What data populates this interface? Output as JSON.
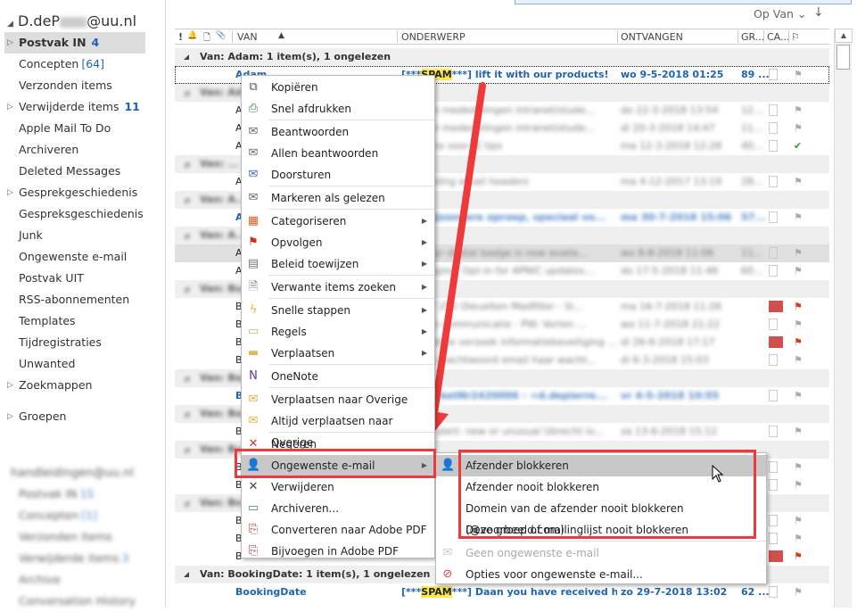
{
  "sidebar": {
    "account": {
      "prefix": "D.deP",
      "suffix": "@uu.nl"
    },
    "folders": [
      {
        "label": "Postvak IN",
        "count": "4",
        "expandable": true,
        "selected": true
      },
      {
        "label": "Concepten",
        "count": "[64]"
      },
      {
        "label": "Verzonden items"
      },
      {
        "label": "Verwijderde items",
        "count": "11",
        "expandable": true
      },
      {
        "label": "Apple Mail To Do"
      },
      {
        "label": "Archiveren"
      },
      {
        "label": "Deleted Messages"
      },
      {
        "label": "Gesprekgeschiedenis",
        "expandable": true
      },
      {
        "label": "Gespreksgeschiedenis"
      },
      {
        "label": "Junk"
      },
      {
        "label": "Ongewenste e-mail"
      },
      {
        "label": "Postvak UIT"
      },
      {
        "label": "RSS-abonnementen"
      },
      {
        "label": "Templates"
      },
      {
        "label": "Tijdregistraties"
      },
      {
        "label": "Unwanted"
      },
      {
        "label": "Zoekmappen",
        "expandable": true
      }
    ],
    "groups_label": "Groepen",
    "second_account": "handleidingen@uu.nl",
    "second_folders": [
      {
        "label": "Postvak IN",
        "count": "15"
      },
      {
        "label": "Concepten",
        "count": "[1]"
      },
      {
        "label": "Verzonden items"
      },
      {
        "label": "Verwijderde items",
        "count": "3"
      },
      {
        "label": "Archive"
      },
      {
        "label": "Conversation History"
      }
    ]
  },
  "toolbar": {
    "sort_label": "Op Van",
    "sort_chevron": "chevron-down-icon",
    "sort_direction": "↓"
  },
  "columns": [
    "!",
    "🔔",
    "🗋",
    "📎",
    "VAN",
    "ONDERWERP",
    "ONTVANGEN",
    "GR...",
    "CA...",
    "⚐"
  ],
  "rows": [
    {
      "kind": "group",
      "text": "Van: Adam: 1 item(s), 1 ongelezen"
    },
    {
      "kind": "item",
      "from": "Adam",
      "tag_open": "[***",
      "spam": "SPAM",
      "tag_close": "***]",
      "subject": " lift it with our products!",
      "date": "wo 9-5-2018 01:25",
      "size": "89 ...",
      "unread": true,
      "selected": true
    },
    {
      "kind": "group",
      "text": "Van: Ad...",
      "blur": true
    },
    {
      "kind": "item",
      "from": "A",
      "subject": "...ws en mededelingen intranet/stude...",
      "date": "do 22-3-2018 13:54",
      "size": "12...",
      "blur": true
    },
    {
      "kind": "item",
      "from": "A",
      "subject": "...ws en mededelingen intranet/stude...",
      "date": "di 20-3-2018 14:47",
      "size": "11...",
      "blur": true
    },
    {
      "kind": "item",
      "from": "A",
      "subject": "...pagina voor IE tips",
      "date": "ma 12-3-2018 12:28",
      "size": "40...",
      "blur": true,
      "check": true
    },
    {
      "kind": "group",
      "text": "Van: ...",
      "blur": true
    },
    {
      "kind": "item",
      "from": "A",
      "subject": "...decoding email headers",
      "date": "ma 4-12-2017 13:19",
      "size": "28...",
      "blur": true
    },
    {
      "kind": "group",
      "text": "Van: A...",
      "blur": true
    },
    {
      "kind": "item",
      "from": "A",
      "subject": "***] Bijzondere oproep, speciaal vo...",
      "date": "ma 30-7-2018 15:06",
      "size": "57...",
      "blur": true,
      "unread": true
    },
    {
      "kind": "group",
      "text": "Van: A...",
      "blur": true
    },
    {
      "kind": "item",
      "from": "A",
      "subject": "***] Your digital badge is now availa...",
      "date": "wo 8-8-2018 11:06",
      "size": "11...",
      "blur": true,
      "hl": true
    },
    {
      "kind": "item",
      "from": "A",
      "subject": "...changing. Opt-in for APNIC updates...",
      "date": "do 17-5-2018 11:46",
      "size": "60...",
      "blur": true
    },
    {
      "kind": "group",
      "text": "Van: Bu...",
      "blur": true
    },
    {
      "kind": "item",
      "from": "B",
      "subject": "...1807 252 Oieuelten Madfilter - Si...",
      "date": "ma 16-7-2018 11:26",
      "size": "",
      "blur": true,
      "redcat": true,
      "redflag": true
    },
    {
      "kind": "item",
      "from": "B",
      "subject": "...ng en communicatie - PW: Vorlen ...",
      "date": "wo 11-7-2018 21:22",
      "size": "",
      "blur": true
    },
    {
      "kind": "item",
      "from": "B",
      "subject": "...rvraatste verzoek informatiebeveiliging ...",
      "date": "di 26-6-2018 17:17",
      "size": "",
      "blur": true,
      "redcat": true,
      "redflag": true
    },
    {
      "kind": "item",
      "from": "B",
      "subject": "...rging wachtwoord email haar wacht...",
      "date": "di 6-3-2018 15:03",
      "size": "",
      "blur": true
    },
    {
      "kind": "group",
      "text": "Van: Boch...",
      "blur": true
    },
    {
      "kind": "item",
      "from": "B",
      "subject": "***] TicketNr2420006 - <d.depierre...",
      "date": "vr 4-5-2018 10:55",
      "size": "",
      "blur": true,
      "unread": true
    },
    {
      "kind": "group",
      "text": "Van: Boo...",
      "blur": true
    },
    {
      "kind": "item",
      "from": "B",
      "subject": "...urity alert: new or unusual Ubrecht lo...",
      "date": "za 13-6-2018 15:12",
      "size": "",
      "blur": true
    },
    {
      "kind": "group",
      "text": "Van: Bo...",
      "blur": true
    },
    {
      "kind": "item",
      "from": "B",
      "subject": "",
      "date": "",
      "size": "",
      "blur": true
    },
    {
      "kind": "item",
      "from": "B",
      "subject": "",
      "date": "",
      "size": "",
      "blur": true
    },
    {
      "kind": "group",
      "text": "Van: Bo...",
      "blur": true
    },
    {
      "kind": "item",
      "from": "B",
      "subject": "",
      "date": "",
      "size": "",
      "blur": true
    },
    {
      "kind": "item",
      "from": "B",
      "subject": "",
      "date": "",
      "size": "",
      "blur": true
    },
    {
      "kind": "item",
      "from": "B",
      "subject": "",
      "date": "",
      "size": "",
      "blur": true,
      "redcat": true,
      "redflag": true
    },
    {
      "kind": "group",
      "text": "Van: BookingDate: 1 item(s), 1 ongelezen"
    },
    {
      "kind": "item",
      "from": "BookingDate",
      "tag_open": "[***",
      "spam": "SPAM",
      "tag_close": "***]",
      "subject": " Daan you have received hook...",
      "date": "zo 29-7-2018 13:02",
      "size": "62 ...",
      "unread": true
    }
  ],
  "context_menu": {
    "items": [
      {
        "label": "Kopiëren",
        "icon": "copy-icon"
      },
      {
        "label": "Snel afdrukken",
        "icon": "quick-print-icon",
        "sep_after": true
      },
      {
        "label": "Beantwoorden",
        "icon": "reply-icon"
      },
      {
        "label": "Allen beantwoorden",
        "icon": "reply-all-icon"
      },
      {
        "label": "Doorsturen",
        "icon": "forward-icon",
        "sep_after": true
      },
      {
        "label": "Markeren als gelezen",
        "icon": "mark-read-icon",
        "sep_after": true
      },
      {
        "label": "Categoriseren",
        "icon": "categorize-icon",
        "submenu": true
      },
      {
        "label": "Opvolgen",
        "icon": "follow-up-flag-icon",
        "submenu": true
      },
      {
        "label": "Beleid toewijzen",
        "icon": "policy-icon",
        "submenu": true,
        "sep_after": true
      },
      {
        "label": "Verwante items zoeken",
        "icon": "related-items-icon",
        "submenu": true,
        "sep_after": true
      },
      {
        "label": "Snelle stappen",
        "icon": "quick-steps-icon",
        "submenu": true
      },
      {
        "label": "Regels",
        "icon": "rules-icon",
        "submenu": true
      },
      {
        "label": "Verplaatsen",
        "icon": "move-icon",
        "submenu": true,
        "sep_after": true
      },
      {
        "label": "OneNote",
        "icon": "onenote-icon",
        "sep_after": true
      },
      {
        "label": "Verplaatsen naar Overige",
        "icon": "move-to-other-icon"
      },
      {
        "label": "Altijd verplaatsen naar Overige",
        "icon": "always-move-other-icon",
        "sep_after": true
      },
      {
        "label": "Negeren",
        "icon": "ignore-icon"
      },
      {
        "label": "Ongewenste e-mail",
        "icon": "junk-email-icon",
        "submenu": true,
        "active": true
      },
      {
        "label": "Verwijderen",
        "icon": "delete-icon"
      },
      {
        "label": "Archiveren...",
        "icon": "archive-icon"
      },
      {
        "label": "Converteren naar Adobe PDF",
        "icon": "adobe-pdf-convert-icon"
      },
      {
        "label": "Bijvoegen in Adobe PDF",
        "icon": "adobe-pdf-attach-icon"
      }
    ]
  },
  "junk_submenu": {
    "items": [
      {
        "label": "Afzender blokkeren",
        "icon": "block-sender-icon",
        "active": true
      },
      {
        "label": "Afzender nooit blokkeren"
      },
      {
        "label": "Domein van de afzender nooit blokkeren (@voorbeeld.com)"
      },
      {
        "label": "Deze groep of mailinglijst nooit blokkeren",
        "sep_after": true
      },
      {
        "label": "Geen ongewenste e-mail",
        "icon": "not-junk-icon",
        "disabled": true
      },
      {
        "label": "Opties voor ongewenste e-mail...",
        "icon": "junk-options-icon"
      }
    ]
  },
  "colors": {
    "accent": "#1e64b4",
    "highlight_box": "#ee3a3a",
    "spam_highlight": "#ffe94d",
    "arrow": "#ee3a3a"
  }
}
